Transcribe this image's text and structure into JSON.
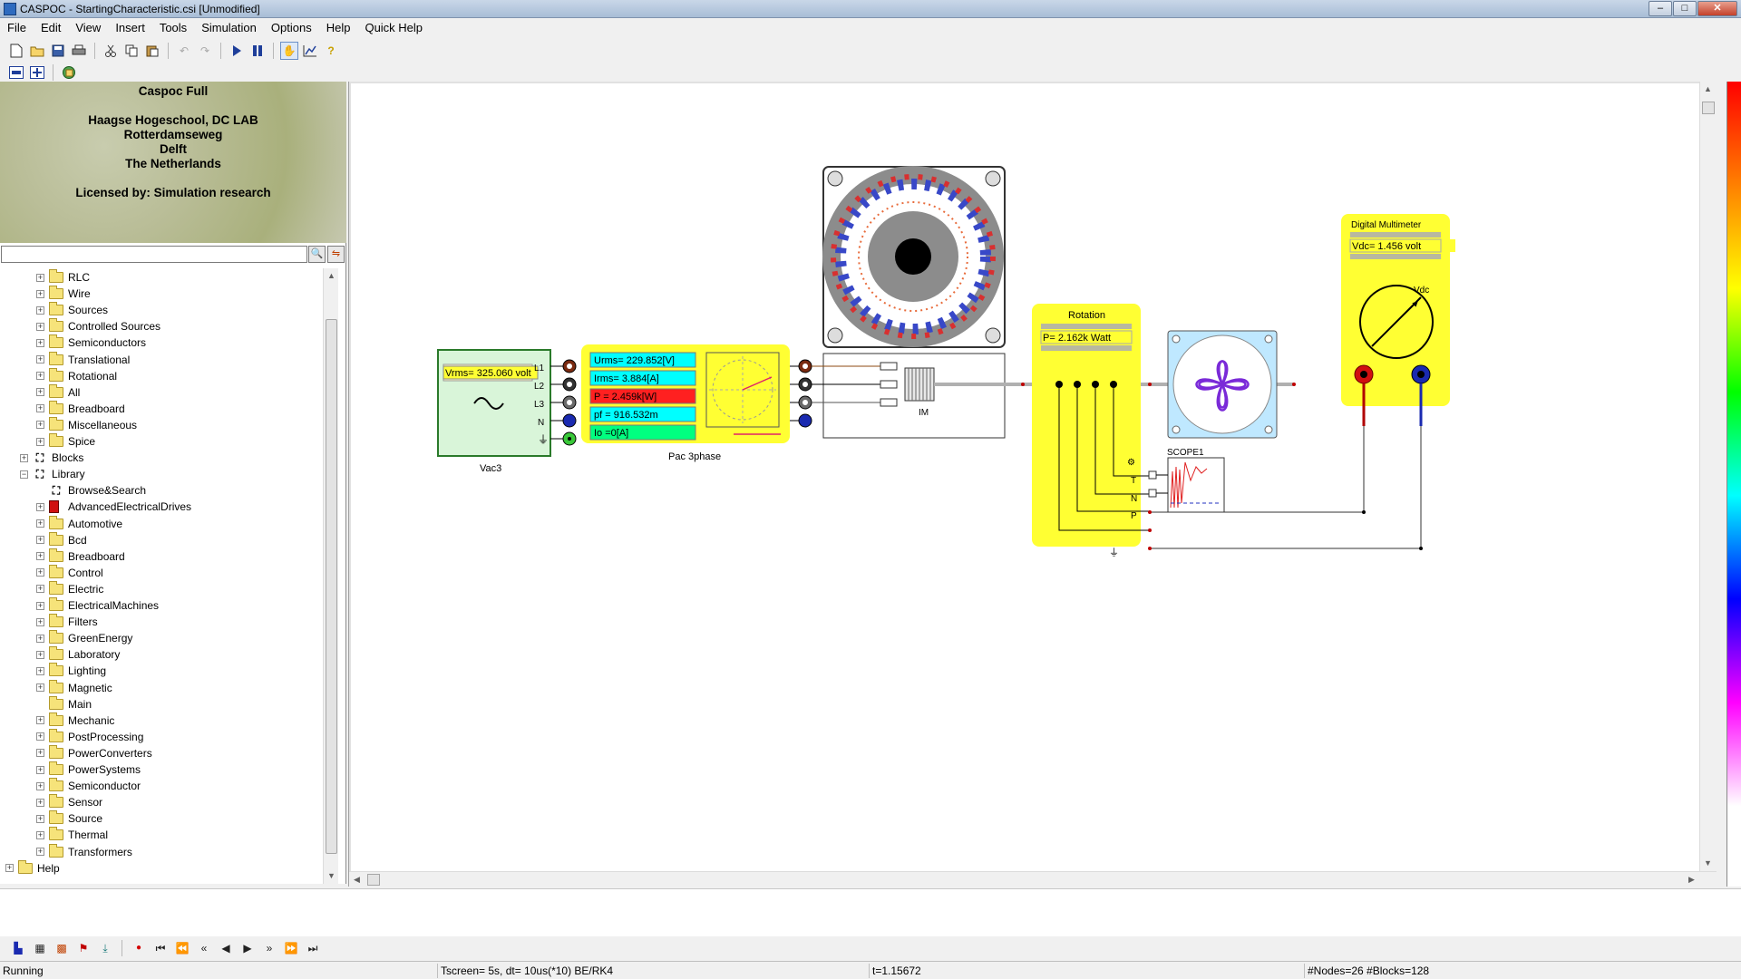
{
  "window": {
    "title": "CASPOC - StartingCharacteristic.csi [Unmodified]",
    "minimize_glyph": "–",
    "maximize_glyph": "□",
    "close_glyph": "✕"
  },
  "menu": [
    "File",
    "Edit",
    "View",
    "Insert",
    "Tools",
    "Simulation",
    "Options",
    "Help",
    "Quick Help"
  ],
  "license": {
    "product": "Caspoc Full",
    "lines": [
      "Haagse Hogeschool, DC LAB",
      "Rotterdamseweg",
      "Delft",
      "The Netherlands"
    ],
    "licensed_by": "Licensed by: Simulation research"
  },
  "search": {
    "value": "",
    "placeholder": ""
  },
  "tree": {
    "items": [
      {
        "label": "RLC",
        "level": 2,
        "expander": "+",
        "icon": "folder-icon"
      },
      {
        "label": "Wire",
        "level": 2,
        "expander": "+",
        "icon": "folder-icon"
      },
      {
        "label": "Sources",
        "level": 2,
        "expander": "+",
        "icon": "folder-icon"
      },
      {
        "label": "Controlled Sources",
        "level": 2,
        "expander": "+",
        "icon": "folder-icon"
      },
      {
        "label": "Semiconductors",
        "level": 2,
        "expander": "+",
        "icon": "folder-icon"
      },
      {
        "label": "Translational",
        "level": 2,
        "expander": "+",
        "icon": "folder-icon"
      },
      {
        "label": "Rotational",
        "level": 2,
        "expander": "+",
        "icon": "folder-icon"
      },
      {
        "label": "All",
        "level": 2,
        "expander": "+",
        "icon": "folder-icon"
      },
      {
        "label": "Breadboard",
        "level": 2,
        "expander": "+",
        "icon": "folder-icon"
      },
      {
        "label": "Miscellaneous",
        "level": 2,
        "expander": "+",
        "icon": "folder-icon"
      },
      {
        "label": "Spice",
        "level": 2,
        "expander": "+",
        "icon": "folder-icon"
      },
      {
        "label": "Blocks",
        "level": 1,
        "expander": "+",
        "icon": "binoculars-icon"
      },
      {
        "label": "Library",
        "level": 1,
        "expander": "−",
        "icon": "binoculars-icon"
      },
      {
        "label": "Browse&Search",
        "level": 2,
        "expander": "",
        "icon": "binoculars-icon"
      },
      {
        "label": "AdvancedElectricalDrives",
        "level": 2,
        "expander": "+",
        "icon": "book-icon"
      },
      {
        "label": "Automotive",
        "level": 2,
        "expander": "+",
        "icon": "folder-icon"
      },
      {
        "label": "Bcd",
        "level": 2,
        "expander": "+",
        "icon": "folder-icon"
      },
      {
        "label": "Breadboard",
        "level": 2,
        "expander": "+",
        "icon": "folder-icon"
      },
      {
        "label": "Control",
        "level": 2,
        "expander": "+",
        "icon": "folder-icon"
      },
      {
        "label": "Electric",
        "level": 2,
        "expander": "+",
        "icon": "folder-icon"
      },
      {
        "label": "ElectricalMachines",
        "level": 2,
        "expander": "+",
        "icon": "folder-icon"
      },
      {
        "label": "Filters",
        "level": 2,
        "expander": "+",
        "icon": "folder-icon"
      },
      {
        "label": "GreenEnergy",
        "level": 2,
        "expander": "+",
        "icon": "folder-icon"
      },
      {
        "label": "Laboratory",
        "level": 2,
        "expander": "+",
        "icon": "folder-icon"
      },
      {
        "label": "Lighting",
        "level": 2,
        "expander": "+",
        "icon": "folder-icon"
      },
      {
        "label": "Magnetic",
        "level": 2,
        "expander": "+",
        "icon": "folder-icon"
      },
      {
        "label": "Main",
        "level": 2,
        "expander": "",
        "icon": "folder-icon"
      },
      {
        "label": "Mechanic",
        "level": 2,
        "expander": "+",
        "icon": "folder-icon"
      },
      {
        "label": "PostProcessing",
        "level": 2,
        "expander": "+",
        "icon": "folder-icon"
      },
      {
        "label": "PowerConverters",
        "level": 2,
        "expander": "+",
        "icon": "folder-icon"
      },
      {
        "label": "PowerSystems",
        "level": 2,
        "expander": "+",
        "icon": "folder-icon"
      },
      {
        "label": "Semiconductor",
        "level": 2,
        "expander": "+",
        "icon": "folder-icon"
      },
      {
        "label": "Sensor",
        "level": 2,
        "expander": "+",
        "icon": "folder-icon"
      },
      {
        "label": "Source",
        "level": 2,
        "expander": "+",
        "icon": "folder-icon"
      },
      {
        "label": "Thermal",
        "level": 2,
        "expander": "+",
        "icon": "folder-icon"
      },
      {
        "label": "Transformers",
        "level": 2,
        "expander": "+",
        "icon": "folder-icon"
      },
      {
        "label": "Help",
        "level": 0,
        "expander": "+",
        "icon": "folder-icon"
      }
    ]
  },
  "schematic": {
    "vac3": {
      "label": "Vac3",
      "display": "Vrms= 325.060 volt",
      "pins": [
        "L1",
        "L2",
        "L3",
        "N"
      ]
    },
    "pac": {
      "label": "Pac 3phase",
      "rows": [
        {
          "text": "Urms= 229.852[V]",
          "color": "#00ffff"
        },
        {
          "text": "Irms= 3.884[A]",
          "color": "#00ffff"
        },
        {
          "text": "P  = 2.459k[W]",
          "color": "#ff2020"
        },
        {
          "text": "pf  = 916.532m",
          "color": "#00ffff"
        },
        {
          "text": "Io  =0[A]",
          "color": "#00ff80"
        }
      ]
    },
    "motor": {
      "label": "IM"
    },
    "rotation": {
      "title": "Rotation",
      "display": "P= 2.162k Watt",
      "pins": [
        "T",
        "N",
        "P"
      ]
    },
    "scope": {
      "label": "SCOPE1"
    },
    "multimeter": {
      "title": "Digital Multimeter",
      "display": "Vdc= 1.456 volt",
      "dial_label": "Vdc"
    },
    "colors": {
      "module_yellow": "#ffff33",
      "block_green": "#d9f5d9",
      "wire": "#000000",
      "shaft": "#b0b0b0"
    }
  },
  "status": {
    "state": "Running",
    "sim_settings": "Tscreen= 5s, dt= 10us(*10) BE/RK4",
    "time": "t=1.15672",
    "counts": "#Nodes=26 #Blocks=128"
  }
}
